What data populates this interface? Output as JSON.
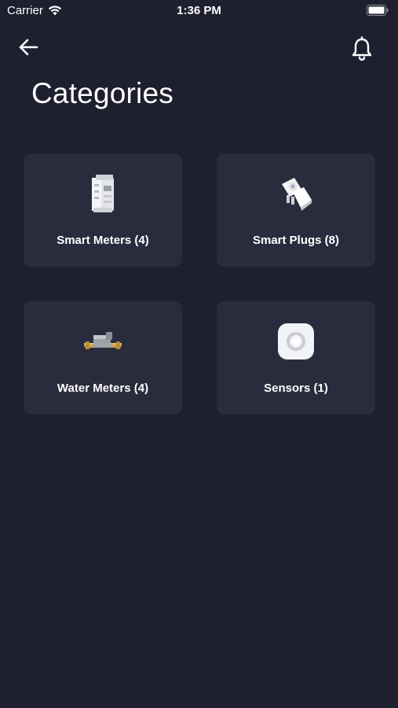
{
  "status_bar": {
    "carrier": "Carrier",
    "time": "1:36 PM"
  },
  "header": {
    "title": "Categories"
  },
  "categories": [
    {
      "label": "Smart Meters (4)",
      "icon": "smart-meter-icon"
    },
    {
      "label": "Smart Plugs (8)",
      "icon": "smart-plug-icon"
    },
    {
      "label": "Water Meters (4)",
      "icon": "water-meter-icon"
    },
    {
      "label": "Sensors (1)",
      "icon": "sensor-icon"
    }
  ],
  "colors": {
    "background": "#1e1f2f",
    "card": "#2a2c3e",
    "text": "#ffffff"
  }
}
